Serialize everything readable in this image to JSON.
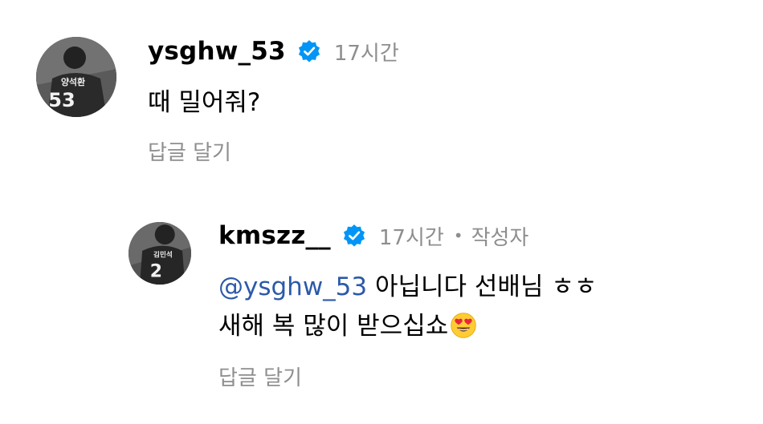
{
  "comments": [
    {
      "username": "ysghw_53",
      "verified": true,
      "time": "17시간",
      "text": "때 밀어줘?",
      "reply_label": "답글 달기",
      "avatar": {
        "jersey_number": "53",
        "jersey_name": "양석환"
      }
    },
    {
      "username": "kmszz__",
      "verified": true,
      "time": "17시간",
      "author_badge": "작성자",
      "mention": "@ysghw_53",
      "text_line1": " 아닙니다 선배님 ㅎㅎ",
      "text_line2": "새해 복 많이 받으십쇼",
      "emoji": "smiling-face-with-heart-eyes",
      "reply_label": "답글 달기",
      "avatar": {
        "jersey_number": "2",
        "jersey_name": "김민석"
      }
    }
  ],
  "colors": {
    "verified": "#0095f6",
    "mention": "#2c5aa8",
    "muted": "#8e8e8e"
  }
}
